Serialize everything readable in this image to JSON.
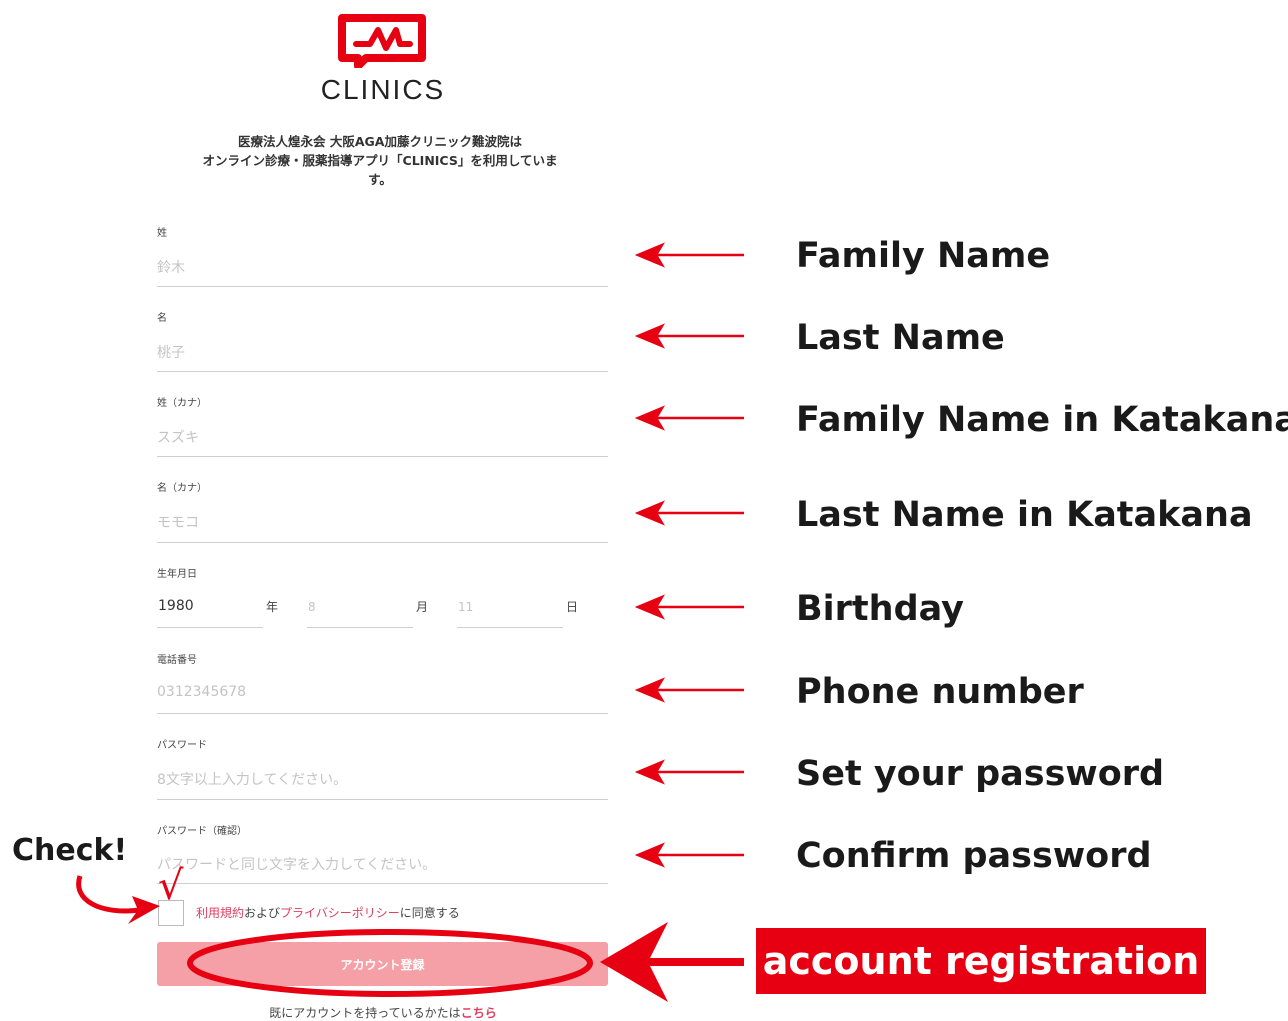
{
  "logo": {
    "text": "CLINICS",
    "icon": "clinics-logo-icon",
    "color": "#e60012"
  },
  "intro": {
    "line1": "医療法人煌永会 大阪AGA加藤クリニック難波院は",
    "line2": "オンライン診療・服薬指導アプリ「CLINICS」を利用していま",
    "line3": "す。"
  },
  "form": {
    "family_name": {
      "label": "姓",
      "placeholder": "鈴木"
    },
    "last_name": {
      "label": "名",
      "placeholder": "桃子"
    },
    "family_kana": {
      "label": "姓（カナ）",
      "placeholder": "スズキ"
    },
    "last_kana": {
      "label": "名（カナ）",
      "placeholder": "モモコ"
    },
    "birthday": {
      "label": "生年月日",
      "year": "1980",
      "year_unit": "年",
      "month": "8",
      "month_unit": "月",
      "day": "11",
      "day_unit": "日"
    },
    "phone": {
      "label": "電話番号",
      "placeholder": "0312345678"
    },
    "password": {
      "label": "パスワード",
      "placeholder": "8文字以上入力してください。"
    },
    "password_confirm": {
      "label": "パスワード（確認）",
      "placeholder": "パスワードと同じ文字を入力してください。"
    },
    "agree": {
      "terms": "利用規約",
      "and": "および",
      "privacy": "プライバシーポリシー",
      "suffix": "に同意する"
    },
    "register_button": "アカウント登録",
    "login_prefix": "既にアカウントを持っているかたは",
    "login_link": "こちら"
  },
  "annotations": {
    "family_name": "Family Name",
    "last_name": "Last Name",
    "family_kana": "Family Name in Katakana",
    "last_kana": "Last Name in Katakana",
    "birthday": "Birthday",
    "phone": "Phone number",
    "password": "Set your password",
    "password_confirm": "Confirm password",
    "register": "account registration",
    "check": "Check!",
    "checkmark": "√"
  },
  "colors": {
    "accent": "#e60012",
    "button": "#f4a0a6",
    "link": "#e04060"
  }
}
